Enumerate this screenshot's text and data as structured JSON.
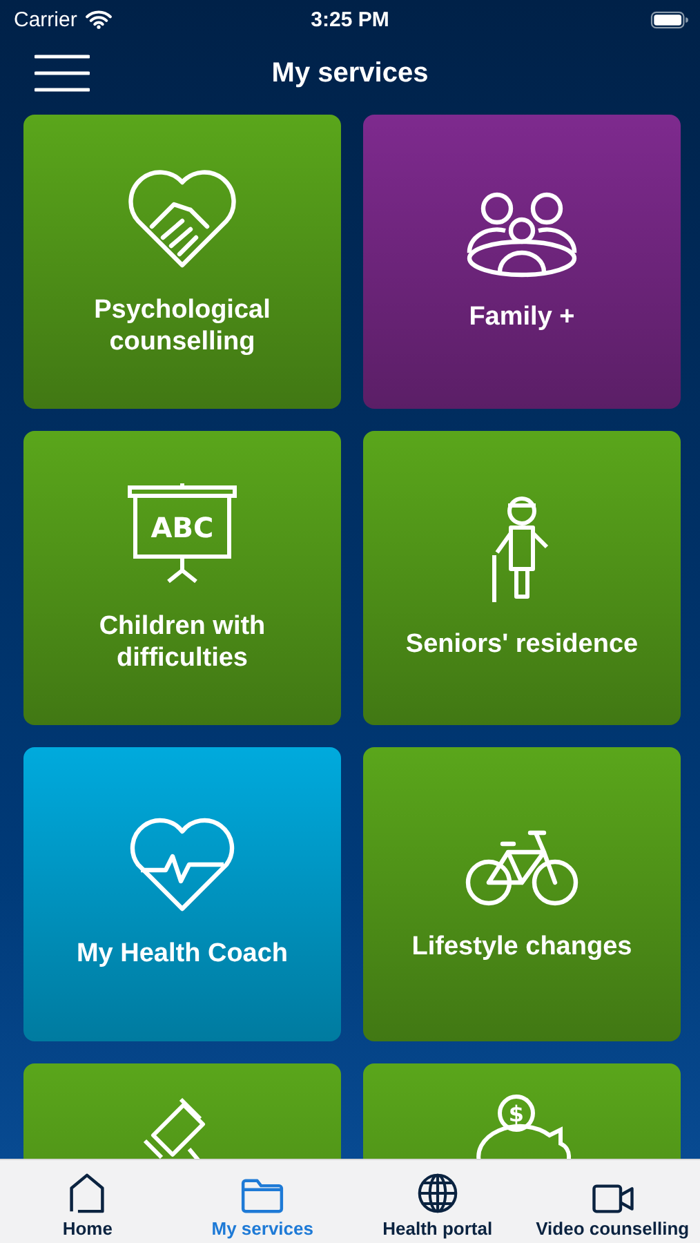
{
  "status_bar": {
    "carrier": "Carrier",
    "time": "3:25 PM"
  },
  "nav": {
    "title": "My services"
  },
  "cards": [
    {
      "label": "Psychological counselling",
      "kind": "handshake",
      "color": "#5aa61b"
    },
    {
      "label": "Family +",
      "kind": "family",
      "color": "#7e2a8e"
    },
    {
      "label": "Children with difficulties",
      "kind": "board",
      "color": "#5aa61b",
      "icon_text": "ABC"
    },
    {
      "label": "Seniors' residence",
      "kind": "senior",
      "color": "#5aa61b"
    },
    {
      "label": "My Health Coach",
      "kind": "heartpulse",
      "color": "#00aadd"
    },
    {
      "label": "Lifestyle changes",
      "kind": "bicycle",
      "color": "#5aa61b"
    },
    {
      "kind": "gavel",
      "color": "#5aa61b"
    },
    {
      "kind": "piggy",
      "color": "#5aa61b",
      "icon_text": "$"
    }
  ],
  "tabs": [
    {
      "label": "Home",
      "kind": "home",
      "selected": false
    },
    {
      "label": "My services",
      "kind": "folder",
      "selected": true
    },
    {
      "label": "Health portal",
      "kind": "globe",
      "selected": false
    },
    {
      "label": "Video counselling",
      "kind": "video",
      "selected": false
    }
  ]
}
